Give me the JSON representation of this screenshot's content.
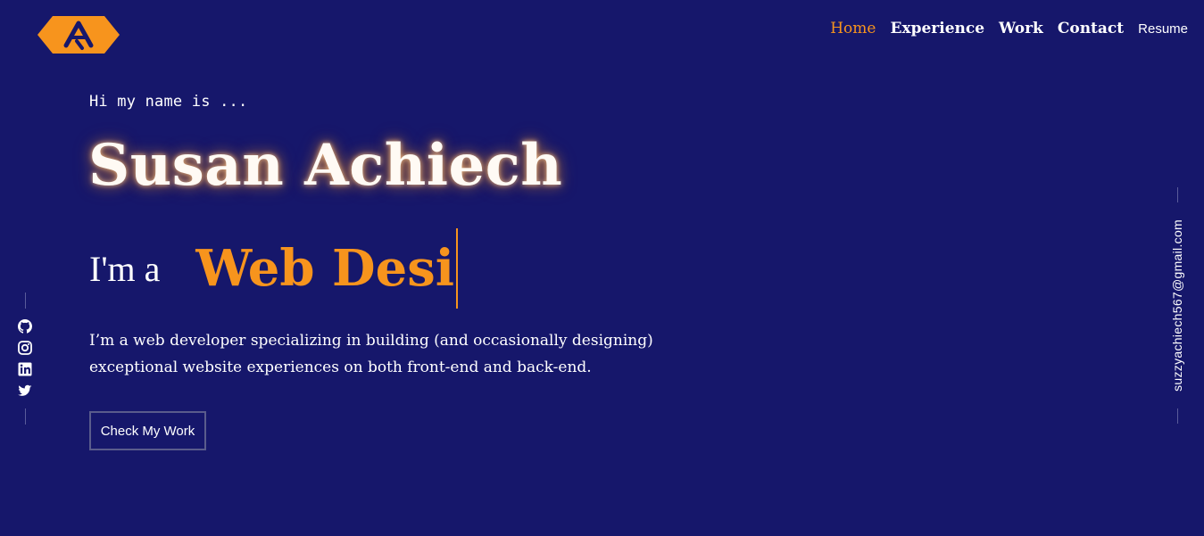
{
  "nav": {
    "items": [
      {
        "label": "Home"
      },
      {
        "label": "Experience"
      },
      {
        "label": "Work"
      },
      {
        "label": "Contact"
      }
    ],
    "resume_label": "Resume"
  },
  "hero": {
    "greeting": "Hi my name is ...",
    "name": "Susan Achiech",
    "role_prefix": "I'm a",
    "role_typed": "Web Desi",
    "bio": "I’m a web developer specializing in building (and occasionally designing) exceptional website experiences on both front-end and back-end.",
    "cta_label": "Check My Work"
  },
  "social": {
    "icons": [
      "github-icon",
      "instagram-icon",
      "linkedin-icon",
      "twitter-icon"
    ]
  },
  "email": "suzzyachiech567@gmail.com",
  "colors": {
    "background": "#16176b",
    "accent": "#f7941d",
    "text": "#ffffff"
  }
}
